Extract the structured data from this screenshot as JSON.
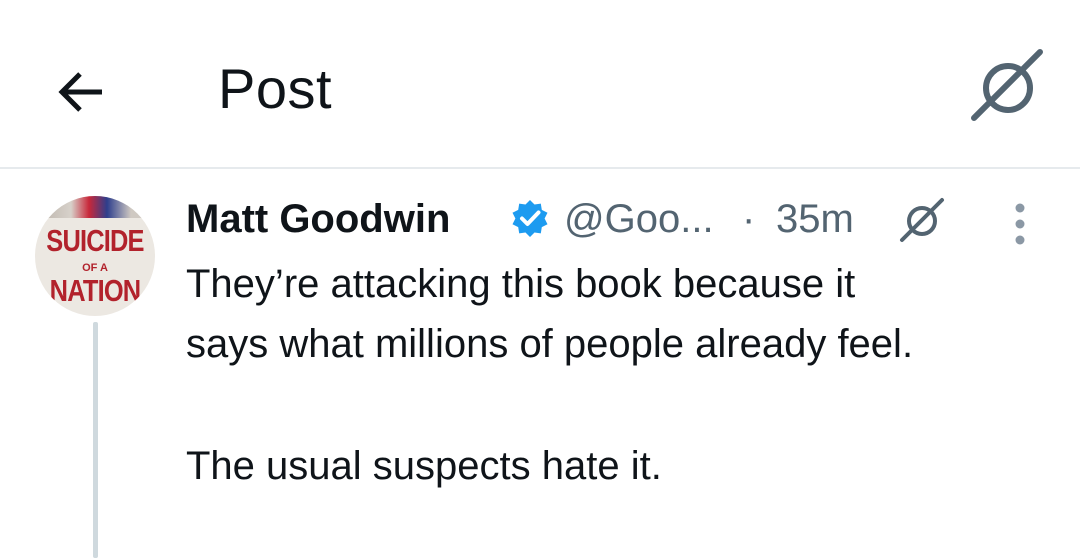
{
  "header": {
    "title": "Post"
  },
  "post": {
    "author_name": "Matt Goodwin",
    "handle": "@Goo...",
    "separator": "·",
    "time": "35m",
    "verified": true,
    "lines": [
      "They’re attacking this book because it",
      "says what millions of people already feel.",
      "The usual suspects hate it."
    ],
    "avatar_text": {
      "line1": "SUICIDE",
      "line2": "OF A",
      "line3": "NATION"
    }
  },
  "icons": {
    "back": "arrow-left-icon",
    "grok": "grok-icon",
    "verified": "verified-badge-icon",
    "more": "more-vertical-icon"
  },
  "colors": {
    "text": "#0f1419",
    "secondary": "#536471",
    "verified": "#1d9bf0",
    "divider": "#e6eaed",
    "thread_line": "#cfd9de"
  }
}
